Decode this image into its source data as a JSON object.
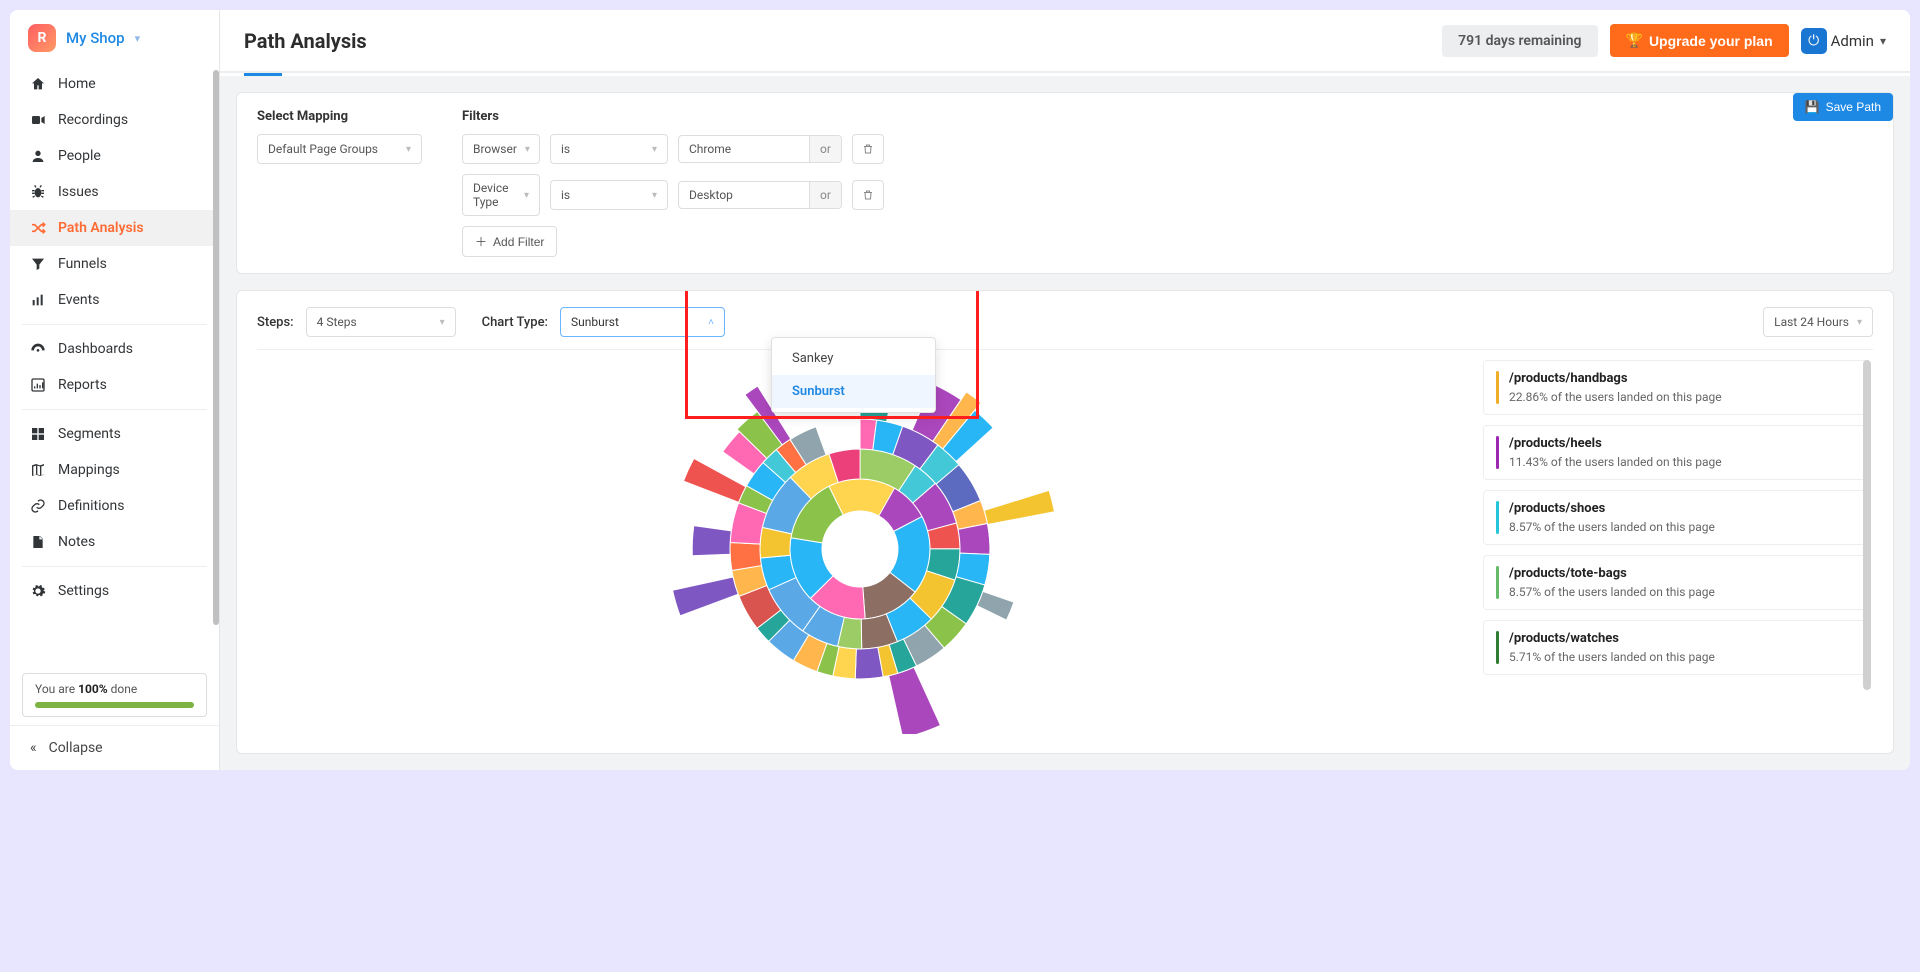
{
  "brand": {
    "name": "My Shop",
    "logo_letter": "R"
  },
  "sidebar": {
    "items": [
      {
        "label": "Home",
        "icon": "home-icon"
      },
      {
        "label": "Recordings",
        "icon": "video-icon"
      },
      {
        "label": "People",
        "icon": "user-icon"
      },
      {
        "label": "Issues",
        "icon": "bug-icon"
      },
      {
        "label": "Path Analysis",
        "icon": "shuffle-icon",
        "active": true
      },
      {
        "label": "Funnels",
        "icon": "funnel-icon"
      },
      {
        "label": "Events",
        "icon": "bars-icon"
      }
    ],
    "group2": [
      {
        "label": "Dashboards",
        "icon": "gauge-icon"
      },
      {
        "label": "Reports",
        "icon": "chart-icon"
      }
    ],
    "group3": [
      {
        "label": "Segments",
        "icon": "grid-icon"
      },
      {
        "label": "Mappings",
        "icon": "map-icon"
      },
      {
        "label": "Definitions",
        "icon": "link-icon"
      },
      {
        "label": "Notes",
        "icon": "note-icon"
      }
    ],
    "group4": [
      {
        "label": "Settings",
        "icon": "gear-icon"
      }
    ],
    "progress_prefix": "You are ",
    "progress_value": "100%",
    "progress_suffix": " done",
    "collapse_label": "Collapse"
  },
  "topbar": {
    "title": "Path Analysis",
    "days_remaining": "791 days remaining",
    "upgrade_label": "Upgrade your plan",
    "admin_label": "Admin"
  },
  "mapping": {
    "label": "Select Mapping",
    "value": "Default Page Groups"
  },
  "filters": {
    "label": "Filters",
    "rows": [
      {
        "field": "Browser",
        "op": "is",
        "value": "Chrome",
        "join": "or"
      },
      {
        "field": "Device Type",
        "op": "is",
        "value": "Desktop",
        "join": "or"
      }
    ],
    "add_label": "Add Filter",
    "save_label": "Save Path"
  },
  "controls": {
    "steps_label": "Steps:",
    "steps_value": "4 Steps",
    "charttype_label": "Chart Type:",
    "charttype_value": "Sunburst",
    "charttype_options": [
      "Sankey",
      "Sunburst"
    ],
    "time_value": "Last 24 Hours"
  },
  "results": {
    "suffix": " of the users landed on this page",
    "items": [
      {
        "path": "/products/handbags",
        "pct": "22.86%",
        "color": "#f0ad28"
      },
      {
        "path": "/products/heels",
        "pct": "11.43%",
        "color": "#9c27b0"
      },
      {
        "path": "/products/shoes",
        "pct": "8.57%",
        "color": "#26c6da"
      },
      {
        "path": "/products/tote-bags",
        "pct": "8.57%",
        "color": "#66bb6a"
      },
      {
        "path": "/products/watches",
        "pct": "5.71%",
        "color": "#2e7d32"
      }
    ]
  },
  "chart_data": {
    "type": "sunburst",
    "rings": 4,
    "note": "Multi-level sunburst of user navigation paths; inner ring = landing pages, outer rings = subsequent steps.",
    "landing_pages": [
      {
        "path": "/products/handbags",
        "pct": 22.86
      },
      {
        "path": "/products/heels",
        "pct": 11.43
      },
      {
        "path": "/products/shoes",
        "pct": 8.57
      },
      {
        "path": "/products/tote-bags",
        "pct": 8.57
      },
      {
        "path": "/products/watches",
        "pct": 5.71
      }
    ]
  }
}
